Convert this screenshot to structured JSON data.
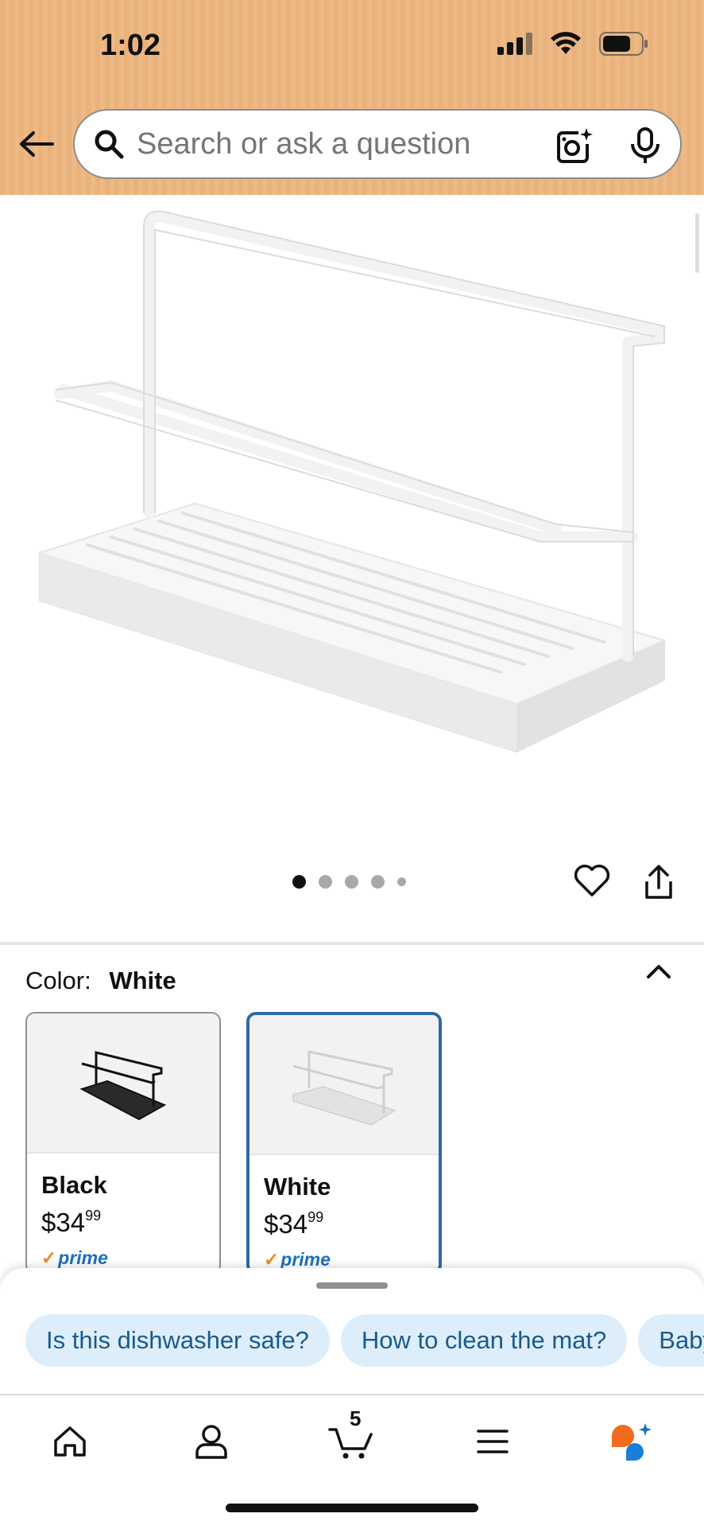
{
  "status_bar": {
    "time": "1:02"
  },
  "search": {
    "placeholder": "Search or ask a question"
  },
  "gallery": {
    "page_count": 5,
    "active_index": 0
  },
  "color_selector": {
    "label": "Color:",
    "selected": "White",
    "options": [
      {
        "name": "Black",
        "price_dollars": "$34",
        "price_cents": "99",
        "badge": "prime"
      },
      {
        "name": "White",
        "price_dollars": "$34",
        "price_cents": "99",
        "badge": "prime"
      }
    ]
  },
  "suggestions": [
    "Is this dishwasher safe?",
    "How to clean the mat?",
    "Baby"
  ],
  "tabbar": {
    "cart_count": "5"
  },
  "colors": {
    "header_bg": "#EDB985",
    "selected_border": "#2F6AA3",
    "chip_bg": "#DDEEFA",
    "chip_text": "#1C5A8C",
    "prime_blue": "#1A6FC0"
  }
}
